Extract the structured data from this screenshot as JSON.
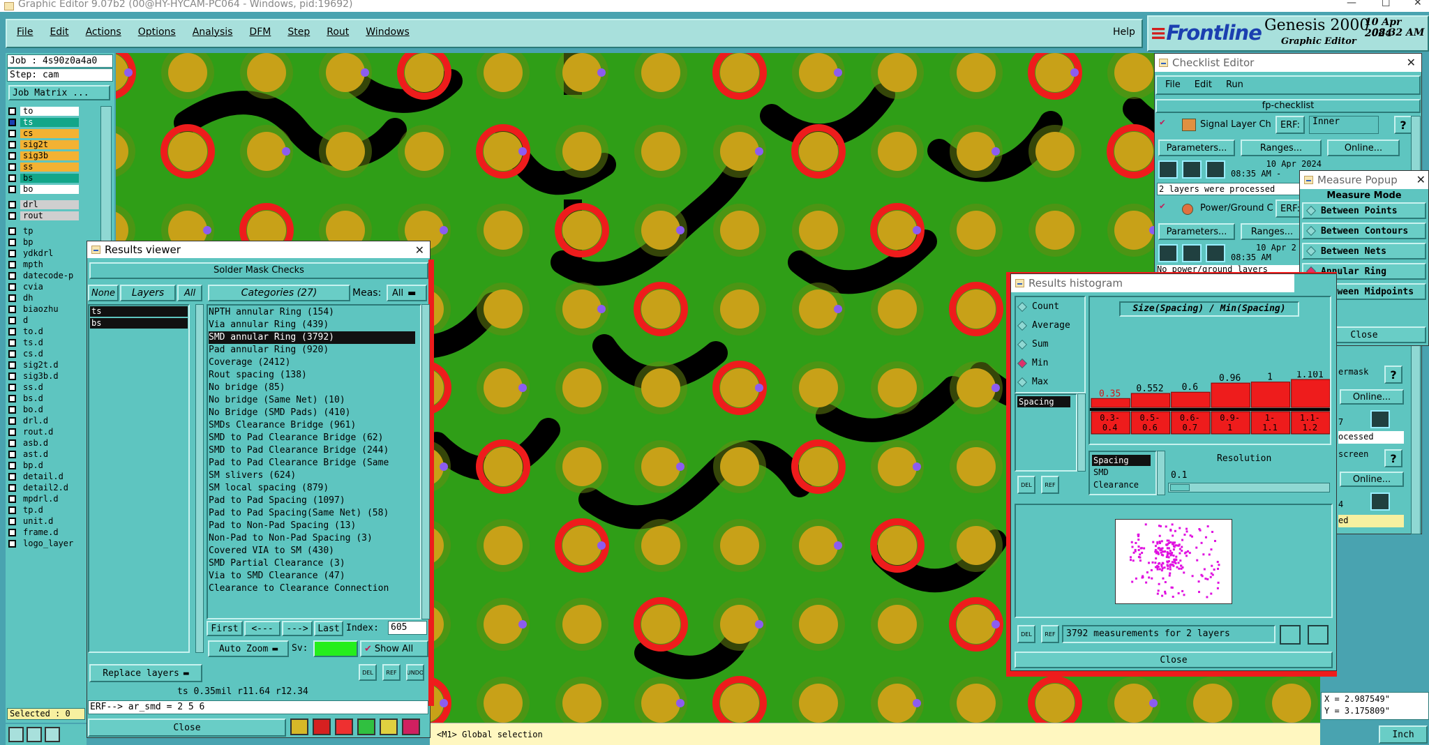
{
  "app": {
    "title": "Graphic Editor 9.07b2 (00@HY-HYCAM-PC064 - Windows, pid:19692)"
  },
  "menu": {
    "items": [
      "File",
      "Edit",
      "Actions",
      "Options",
      "Analysis",
      "DFM",
      "Step",
      "Rout",
      "Windows"
    ],
    "help": "Help"
  },
  "brand": {
    "logo": "Frontline",
    "product": "Genesis 2000",
    "subtitle": "Graphic Editor",
    "date": "10 Apr 2024",
    "time": "08:32 AM"
  },
  "job": {
    "label": "Job : 4s90z0a4a0",
    "step": "Step: cam",
    "matrix_button": "Job Matrix ..."
  },
  "layers": [
    {
      "name": "to",
      "color": "#ffffff"
    },
    {
      "name": "ts",
      "color": "#12a689",
      "active": true
    },
    {
      "name": "cs",
      "color": "#f3b233"
    },
    {
      "name": "sig2t",
      "color": "#f3b233"
    },
    {
      "name": "sig3b",
      "color": "#f3b233"
    },
    {
      "name": "ss",
      "color": "#f3b233"
    },
    {
      "name": "bs",
      "color": "#12a689"
    },
    {
      "name": "bo",
      "color": "#ffffff"
    },
    {
      "name": "drl",
      "color": "#cfcfcf"
    },
    {
      "name": "rout",
      "color": "#cfcfcf"
    },
    {
      "name": "tp",
      "color": "#5ec5c0"
    },
    {
      "name": "bp",
      "color": "#5ec5c0"
    },
    {
      "name": "ydkdrl",
      "color": "#5ec5c0"
    },
    {
      "name": "mpth",
      "color": "#5ec5c0"
    },
    {
      "name": "datecode-p",
      "color": "#5ec5c0"
    },
    {
      "name": "cvia",
      "color": "#5ec5c0"
    },
    {
      "name": "dh",
      "color": "#5ec5c0"
    },
    {
      "name": "biaozhu",
      "color": "#5ec5c0"
    },
    {
      "name": "d",
      "color": "#5ec5c0"
    },
    {
      "name": "to.d",
      "color": "#5ec5c0"
    },
    {
      "name": "ts.d",
      "color": "#5ec5c0"
    },
    {
      "name": "cs.d",
      "color": "#5ec5c0"
    },
    {
      "name": "sig2t.d",
      "color": "#5ec5c0"
    },
    {
      "name": "sig3b.d",
      "color": "#5ec5c0"
    },
    {
      "name": "ss.d",
      "color": "#5ec5c0"
    },
    {
      "name": "bs.d",
      "color": "#5ec5c0"
    },
    {
      "name": "bo.d",
      "color": "#5ec5c0"
    },
    {
      "name": "drl.d",
      "color": "#5ec5c0"
    },
    {
      "name": "rout.d",
      "color": "#5ec5c0"
    },
    {
      "name": "asb.d",
      "color": "#5ec5c0"
    },
    {
      "name": "ast.d",
      "color": "#5ec5c0"
    },
    {
      "name": "bp.d",
      "color": "#5ec5c0"
    },
    {
      "name": "detail.d",
      "color": "#5ec5c0"
    },
    {
      "name": "detail2.d",
      "color": "#5ec5c0"
    },
    {
      "name": "mpdrl.d",
      "color": "#5ec5c0"
    },
    {
      "name": "tp.d",
      "color": "#5ec5c0"
    },
    {
      "name": "unit.d",
      "color": "#5ec5c0"
    },
    {
      "name": "frame.d",
      "color": "#5ec5c0"
    },
    {
      "name": "logo_layer",
      "color": "#5ec5c0"
    }
  ],
  "selected": "Selected : 0",
  "results_viewer": {
    "title": "Results viewer",
    "header": "Solder Mask Checks",
    "none": "None",
    "layers": "Layers",
    "all": "All",
    "categories": "Categories (27)",
    "meas_label": "Meas:",
    "meas_value": "All",
    "layer_list": [
      "ts",
      "bs"
    ],
    "items": [
      "NPTH annular Ring (154)",
      "Via annular Ring (439)",
      "SMD annular Ring (3792)",
      "Pad annular Ring (920)",
      "Coverage (2412)",
      "Rout spacing (138)",
      "No bridge (85)",
      "No bridge (Same Net) (10)",
      "No Bridge (SMD Pads) (410)",
      "SMDs Clearance Bridge (961)",
      "SMD to Pad Clearance Bridge (62)",
      "SMD to Pad Clearance Bridge (244)",
      "Pad to Pad Clearance Bridge (Same",
      "SM slivers (624)",
      "SM local spacing (879)",
      "Pad to Pad Spacing (1097)",
      "Pad to Pad Spacing(Same Net) (58)",
      "Pad to Non-Pad Spacing (13)",
      "Non-Pad to Non-Pad Spacing (3)",
      "Covered VIA to SM (430)",
      "SMD Partial Clearance (3)",
      "Via to SMD Clearance (47)",
      "Clearance to Clearance Connection"
    ],
    "selected_index": 2,
    "nav": {
      "first": "First",
      "prev": "<---",
      "next": "--->",
      "last": "Last",
      "index_label": "Index:",
      "index_value": "605"
    },
    "auto_zoom": "Auto Zoom",
    "sv": "Sv:",
    "show_all": "Show All",
    "replace_layers": "Replace layers",
    "status": "ts 0.35mil  r11.64  r12.34",
    "erf": "ERF--> ar_smd = 2 5 6",
    "close": "Close"
  },
  "checklist": {
    "title": "Checklist Editor",
    "menu": [
      "File",
      "Edit",
      "Run"
    ],
    "name": "fp-checklist",
    "checks": [
      {
        "name": "Signal Layer Ch",
        "erf": "ERF:",
        "erf_value": "Inner",
        "date": "10 Apr 2024",
        "time": "08:35 AM -",
        "status": "2 layers were processed"
      },
      {
        "name": "Power/Ground C",
        "erf": "ERF:",
        "erf_value": "",
        "date": "10 Apr 2",
        "time": "08:35 AM",
        "status": "No power/ground layers"
      }
    ],
    "parameters": "Parameters...",
    "ranges": "Ranges...",
    "online": "Online...",
    "partial": {
      "ermask": "ermask",
      "online1": "Online...",
      "processed": "ocessed",
      "screen": "screen",
      "online2": "Online...",
      "ed": "ed",
      "seven": "7",
      "four": "4"
    }
  },
  "measure": {
    "title": "Measure Popup",
    "mode_label": "Measure Mode",
    "modes": [
      "Between Points",
      "Between Contours",
      "Between Nets",
      "Annular Ring",
      "Between Midpoints"
    ],
    "selected_mode": 3,
    "close": "Close"
  },
  "histogram": {
    "title": "Results histogram",
    "stats": [
      "Count",
      "Average",
      "Sum",
      "Min",
      "Max"
    ],
    "selected_stat": 3,
    "left_list": [
      "Spacing"
    ],
    "chart_title": "Size(Spacing) / Min(Spacing)",
    "attr_list": [
      "Spacing",
      "SMD",
      "Clearance"
    ],
    "resolution_label": "Resolution",
    "resolution_value": "0.1",
    "summary": "3792 measurements for 2 layers",
    "close": "Close",
    "del": "DEL",
    "ref": "REF"
  },
  "chart_data": {
    "type": "bar",
    "title": "Size(Spacing) / Min(Spacing)",
    "categories": [
      "0.3-0.4",
      "0.5-0.6",
      "0.6-0.7",
      "0.9-1",
      "1-1.1",
      "1.1-1.2"
    ],
    "category_lines": [
      [
        "0.3-",
        "0.4"
      ],
      [
        "0.5-",
        "0.6"
      ],
      [
        "0.6-",
        "0.7"
      ],
      [
        "0.9-",
        "1"
      ],
      [
        "1-",
        "1.1"
      ],
      [
        "1.1-",
        "1.2"
      ]
    ],
    "values": [
      0.35,
      0.552,
      0.6,
      0.96,
      1,
      1.101
    ],
    "value_labels": [
      "0.35",
      "0.552",
      "0.6",
      "0.96",
      "1",
      "1.101"
    ],
    "bar_color": "#ee1c1c"
  },
  "canvas": {
    "status": "<M1> Global selection",
    "x": "X = 2.987549\"",
    "y": "Y = 3.175809\"",
    "unit": "Inch"
  },
  "colors": {
    "board": "#2f9e17",
    "pad": "#c8a118",
    "mask": "#ee1c1c",
    "copper": "#000000",
    "via": "#8c5cf0",
    "panel": "#5ec5c0"
  }
}
